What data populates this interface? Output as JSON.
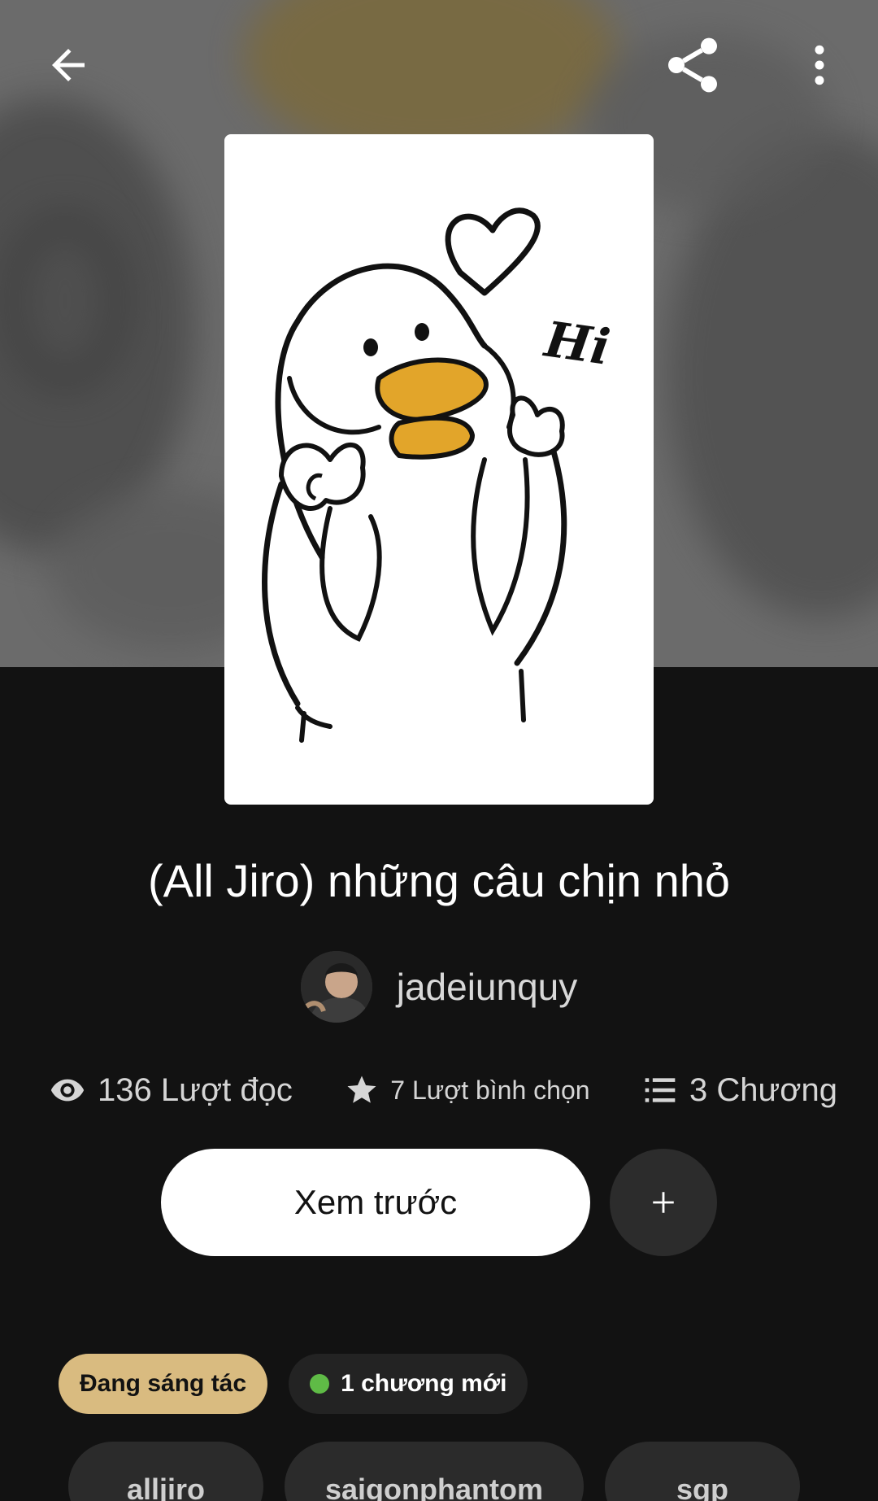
{
  "header": {
    "back_icon": "arrow-left-icon",
    "share_icon": "share-icon",
    "more_icon": "more-vertical-icon"
  },
  "cover": {
    "text": "Hi"
  },
  "story": {
    "title": "(All Jiro) những câu chịn nhỏ",
    "author": "jadeiunquy"
  },
  "stats": {
    "reads": "136 Lượt đọc",
    "votes": "7 Lượt bình chọn",
    "chapters": "3 Chương"
  },
  "actions": {
    "preview_label": "Xem trước",
    "add_label": "+"
  },
  "badges": {
    "status": "Đang sáng tác",
    "new_chapters": "1 chương mới"
  },
  "tags": [
    "alljiro",
    "saigonphantom",
    "sgp"
  ],
  "colors": {
    "background": "#121212",
    "status_badge": "#d9bb80",
    "new_dot": "#5fbb46"
  }
}
